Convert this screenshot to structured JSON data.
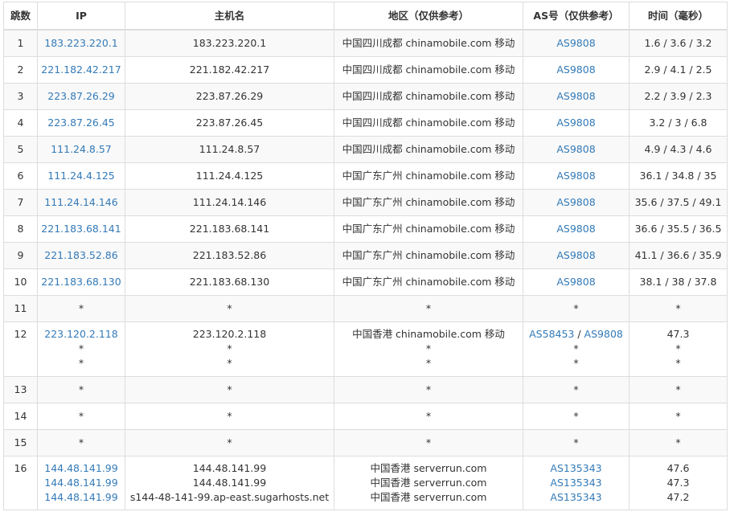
{
  "headers": [
    "跳数",
    "IP",
    "主机名",
    "地区（仅供参考）",
    "AS号（仅供参考）",
    "时间（毫秒）"
  ],
  "rows": [
    {
      "hop": "1",
      "ips": [
        "183.223.220.1"
      ],
      "hosts": [
        "183.223.220.1"
      ],
      "regions": [
        "中国四川成都 chinamobile.com 移动"
      ],
      "asns": [
        [
          "AS9808"
        ]
      ],
      "times": [
        "1.6 / 3.6 / 3.2"
      ]
    },
    {
      "hop": "2",
      "ips": [
        "221.182.42.217"
      ],
      "hosts": [
        "221.182.42.217"
      ],
      "regions": [
        "中国四川成都 chinamobile.com 移动"
      ],
      "asns": [
        [
          "AS9808"
        ]
      ],
      "times": [
        "2.9 / 4.1 / 2.5"
      ]
    },
    {
      "hop": "3",
      "ips": [
        "223.87.26.29"
      ],
      "hosts": [
        "223.87.26.29"
      ],
      "regions": [
        "中国四川成都 chinamobile.com 移动"
      ],
      "asns": [
        [
          "AS9808"
        ]
      ],
      "times": [
        "2.2 / 3.9 / 2.3"
      ]
    },
    {
      "hop": "4",
      "ips": [
        "223.87.26.45"
      ],
      "hosts": [
        "223.87.26.45"
      ],
      "regions": [
        "中国四川成都 chinamobile.com 移动"
      ],
      "asns": [
        [
          "AS9808"
        ]
      ],
      "times": [
        "3.2 / 3 / 6.8"
      ]
    },
    {
      "hop": "5",
      "ips": [
        "111.24.8.57"
      ],
      "hosts": [
        "111.24.8.57"
      ],
      "regions": [
        "中国四川成都 chinamobile.com 移动"
      ],
      "asns": [
        [
          "AS9808"
        ]
      ],
      "times": [
        "4.9 / 4.3 / 4.6"
      ]
    },
    {
      "hop": "6",
      "ips": [
        "111.24.4.125"
      ],
      "hosts": [
        "111.24.4.125"
      ],
      "regions": [
        "中国广东广州 chinamobile.com 移动"
      ],
      "asns": [
        [
          "AS9808"
        ]
      ],
      "times": [
        "36.1 / 34.8 / 35"
      ]
    },
    {
      "hop": "7",
      "ips": [
        "111.24.14.146"
      ],
      "hosts": [
        "111.24.14.146"
      ],
      "regions": [
        "中国广东广州 chinamobile.com 移动"
      ],
      "asns": [
        [
          "AS9808"
        ]
      ],
      "times": [
        "35.6 / 37.5 / 49.1"
      ]
    },
    {
      "hop": "8",
      "ips": [
        "221.183.68.141"
      ],
      "hosts": [
        "221.183.68.141"
      ],
      "regions": [
        "中国广东广州 chinamobile.com 移动"
      ],
      "asns": [
        [
          "AS9808"
        ]
      ],
      "times": [
        "36.6 / 35.5 / 36.5"
      ]
    },
    {
      "hop": "9",
      "ips": [
        "221.183.52.86"
      ],
      "hosts": [
        "221.183.52.86"
      ],
      "regions": [
        "中国广东广州 chinamobile.com 移动"
      ],
      "asns": [
        [
          "AS9808"
        ]
      ],
      "times": [
        "41.1 / 36.6 / 35.9"
      ]
    },
    {
      "hop": "10",
      "ips": [
        "221.183.68.130"
      ],
      "hosts": [
        "221.183.68.130"
      ],
      "regions": [
        "中国广东广州 chinamobile.com 移动"
      ],
      "asns": [
        [
          "AS9808"
        ]
      ],
      "times": [
        "38.1 / 38 / 37.8"
      ]
    },
    {
      "hop": "11",
      "ips": [
        "*"
      ],
      "hosts": [
        "*"
      ],
      "regions": [
        "*"
      ],
      "asns": [
        [
          "*"
        ]
      ],
      "times": [
        "*"
      ]
    },
    {
      "hop": "12",
      "ips": [
        "223.120.2.118",
        "*",
        "*"
      ],
      "hosts": [
        "223.120.2.118",
        "*",
        "*"
      ],
      "regions": [
        "中国香港 chinamobile.com 移动",
        "*",
        "*"
      ],
      "asns": [
        [
          "AS58453",
          "AS9808"
        ],
        [
          "*"
        ],
        [
          "*"
        ]
      ],
      "times": [
        "47.3",
        "*",
        "*"
      ]
    },
    {
      "hop": "13",
      "ips": [
        "*"
      ],
      "hosts": [
        "*"
      ],
      "regions": [
        "*"
      ],
      "asns": [
        [
          "*"
        ]
      ],
      "times": [
        "*"
      ]
    },
    {
      "hop": "14",
      "ips": [
        "*"
      ],
      "hosts": [
        "*"
      ],
      "regions": [
        "*"
      ],
      "asns": [
        [
          "*"
        ]
      ],
      "times": [
        "*"
      ]
    },
    {
      "hop": "15",
      "ips": [
        "*"
      ],
      "hosts": [
        "*"
      ],
      "regions": [
        "*"
      ],
      "asns": [
        [
          "*"
        ]
      ],
      "times": [
        "*"
      ]
    },
    {
      "hop": "16",
      "ips": [
        "144.48.141.99",
        "144.48.141.99",
        "144.48.141.99"
      ],
      "hosts": [
        "144.48.141.99",
        "144.48.141.99",
        "s144-48-141-99.ap-east.sugarhosts.net"
      ],
      "regions": [
        "中国香港 serverrun.com",
        "中国香港 serverrun.com",
        "中国香港 serverrun.com"
      ],
      "asns": [
        [
          "AS135343"
        ],
        [
          "AS135343"
        ],
        [
          "AS135343"
        ]
      ],
      "times": [
        "47.6",
        "47.3",
        "47.2"
      ]
    }
  ],
  "colors": {
    "link": "#337ab7",
    "text": "#333333",
    "border": "#dddddd",
    "stripe": "#f9f9f9"
  }
}
